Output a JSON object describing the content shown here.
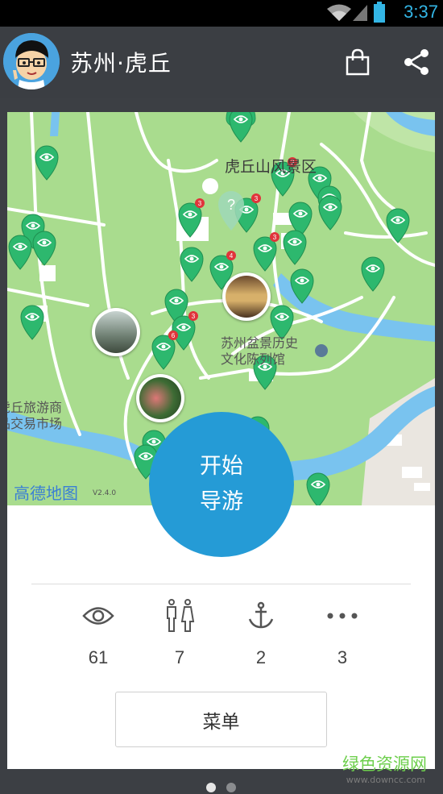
{
  "status_bar": {
    "time": "3:37"
  },
  "header": {
    "title": "苏州·虎丘"
  },
  "map": {
    "labels": [
      "虎丘山风景区",
      "苏州盆景历史",
      "文化陈列馆",
      "虎丘旅游商",
      "品交易市场"
    ],
    "brand": "高德地图",
    "version": "V2.4.0"
  },
  "start_button": {
    "line1": "开始",
    "line2": "导游"
  },
  "stats": [
    {
      "icon": "eye-icon",
      "value": "61"
    },
    {
      "icon": "restroom-icon",
      "value": "7"
    },
    {
      "icon": "anchor-icon",
      "value": "2"
    },
    {
      "icon": "more-icon",
      "value": "3"
    }
  ],
  "menu_button": {
    "label": "菜单"
  },
  "watermark": {
    "text": "绿色资源网",
    "url": "www.downcc.com"
  },
  "colors": {
    "accent": "#259bd6",
    "pin": "#2db86e",
    "badge": "#e0343b",
    "header": "#3b3e43"
  }
}
